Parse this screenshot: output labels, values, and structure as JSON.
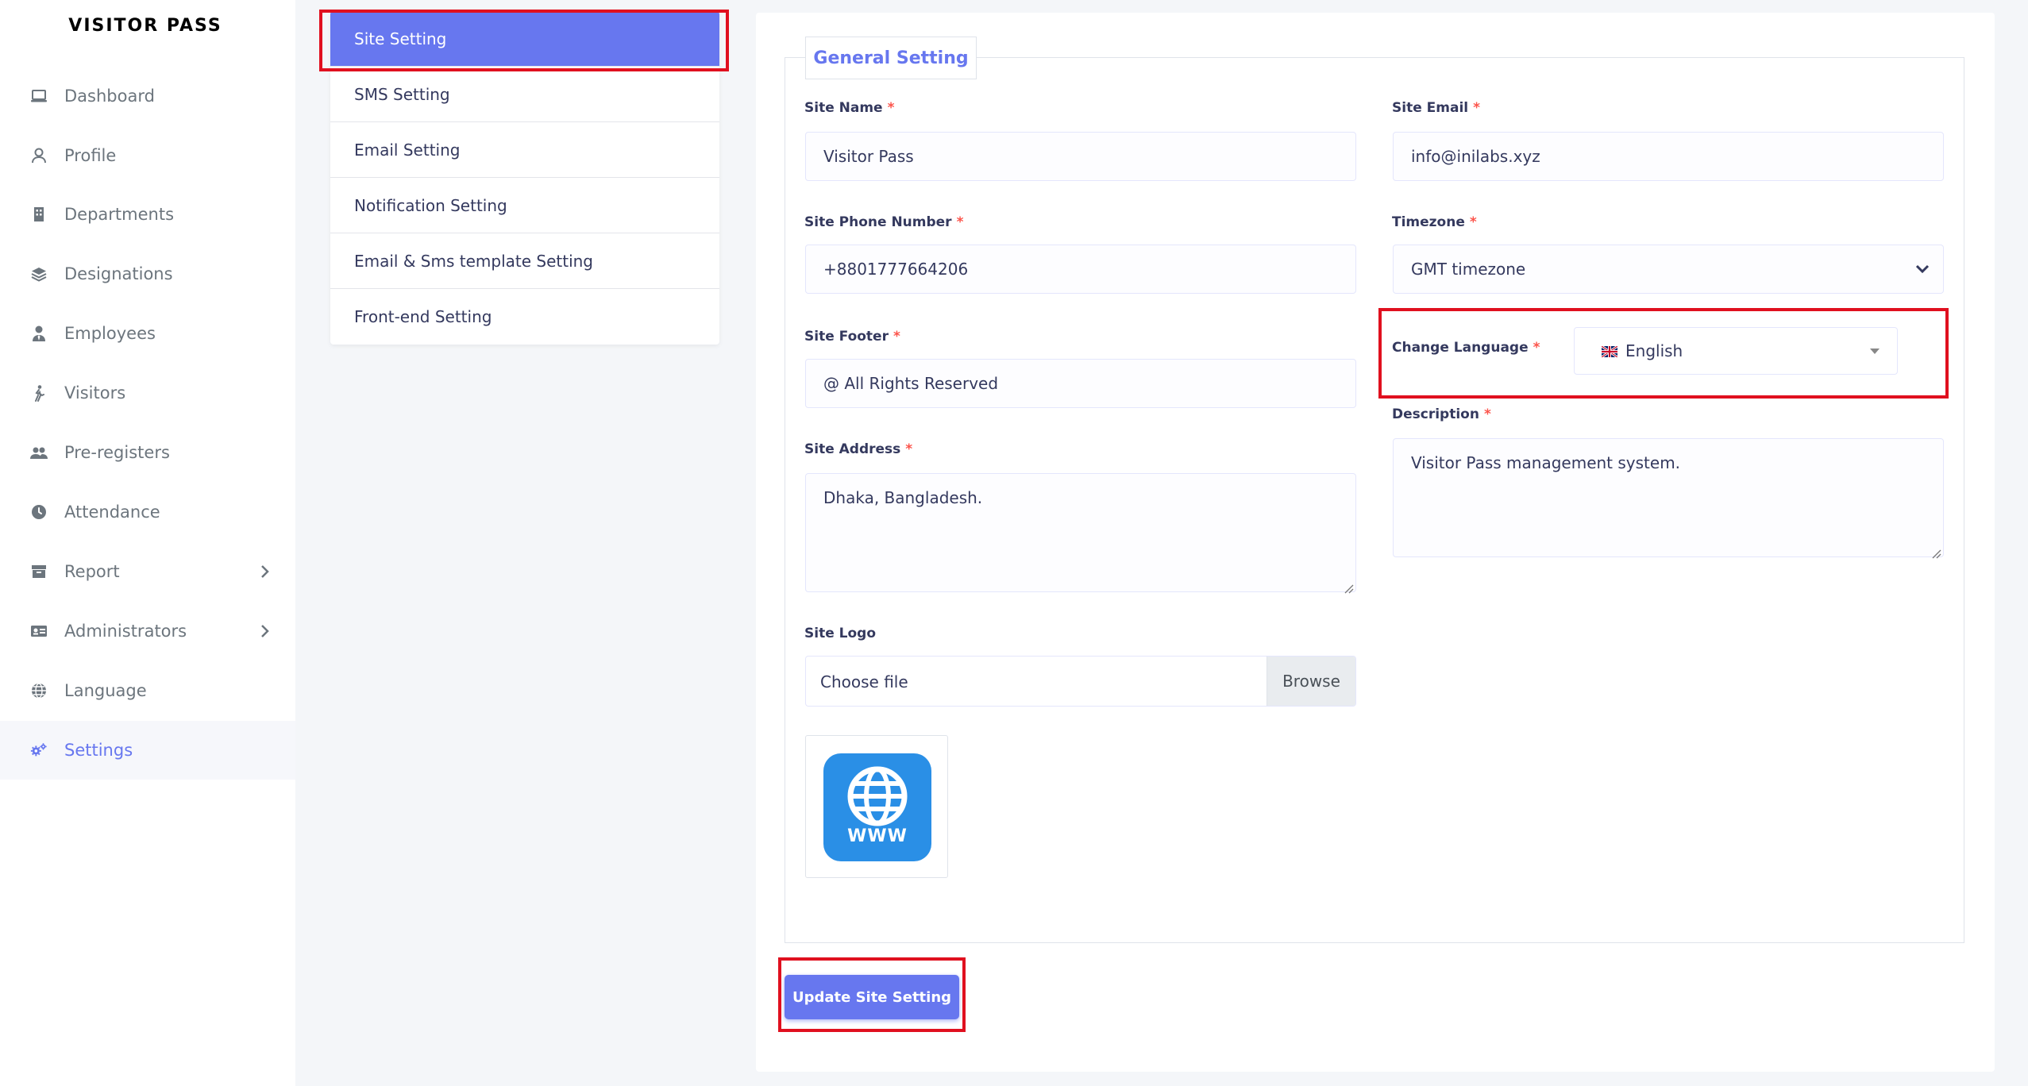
{
  "brand": "VISITOR PASS",
  "colors": {
    "accent": "#6777ef",
    "highlight": "#e0101f",
    "required": "#fc544b"
  },
  "sidebar": {
    "items": [
      {
        "label": "Dashboard",
        "icon": "laptop-icon"
      },
      {
        "label": "Profile",
        "icon": "user-icon"
      },
      {
        "label": "Departments",
        "icon": "building-icon"
      },
      {
        "label": "Designations",
        "icon": "layers-icon"
      },
      {
        "label": "Employees",
        "icon": "user-tie-icon"
      },
      {
        "label": "Visitors",
        "icon": "walking-icon"
      },
      {
        "label": "Pre-registers",
        "icon": "users-icon"
      },
      {
        "label": "Attendance",
        "icon": "clock-icon"
      },
      {
        "label": "Report",
        "icon": "archive-icon",
        "has_submenu": true
      },
      {
        "label": "Administrators",
        "icon": "id-card-icon",
        "has_submenu": true
      },
      {
        "label": "Language",
        "icon": "globe-icon"
      },
      {
        "label": "Settings",
        "icon": "cogs-icon",
        "active": true
      }
    ]
  },
  "settings_menu": {
    "items": [
      {
        "label": "Site Setting",
        "active": true
      },
      {
        "label": "SMS Setting"
      },
      {
        "label": "Email Setting"
      },
      {
        "label": "Notification Setting"
      },
      {
        "label": "Email & Sms template Setting"
      },
      {
        "label": "Front-end Setting"
      }
    ]
  },
  "form": {
    "legend": "General Setting",
    "site_name": {
      "label": "Site Name",
      "value": "Visitor Pass"
    },
    "site_email": {
      "label": "Site Email",
      "value": "info@inilabs.xyz"
    },
    "site_phone": {
      "label": "Site Phone Number",
      "value": "+8801777664206"
    },
    "timezone": {
      "label": "Timezone",
      "value": "GMT timezone"
    },
    "site_footer": {
      "label": "Site Footer",
      "value": "@ All Rights Reserved"
    },
    "change_language": {
      "label": "Change Language",
      "value": "English",
      "flag_icon": "uk-flag-icon"
    },
    "description": {
      "label": "Description",
      "value": "Visitor Pass management system."
    },
    "site_address": {
      "label": "Site Address",
      "value": "Dhaka, Bangladesh."
    },
    "site_logo": {
      "label": "Site Logo",
      "file_text": "Choose file",
      "browse_label": "Browse",
      "logo_caption": "WWW"
    },
    "required_mark": "*",
    "submit_label": "Update Site Setting"
  }
}
